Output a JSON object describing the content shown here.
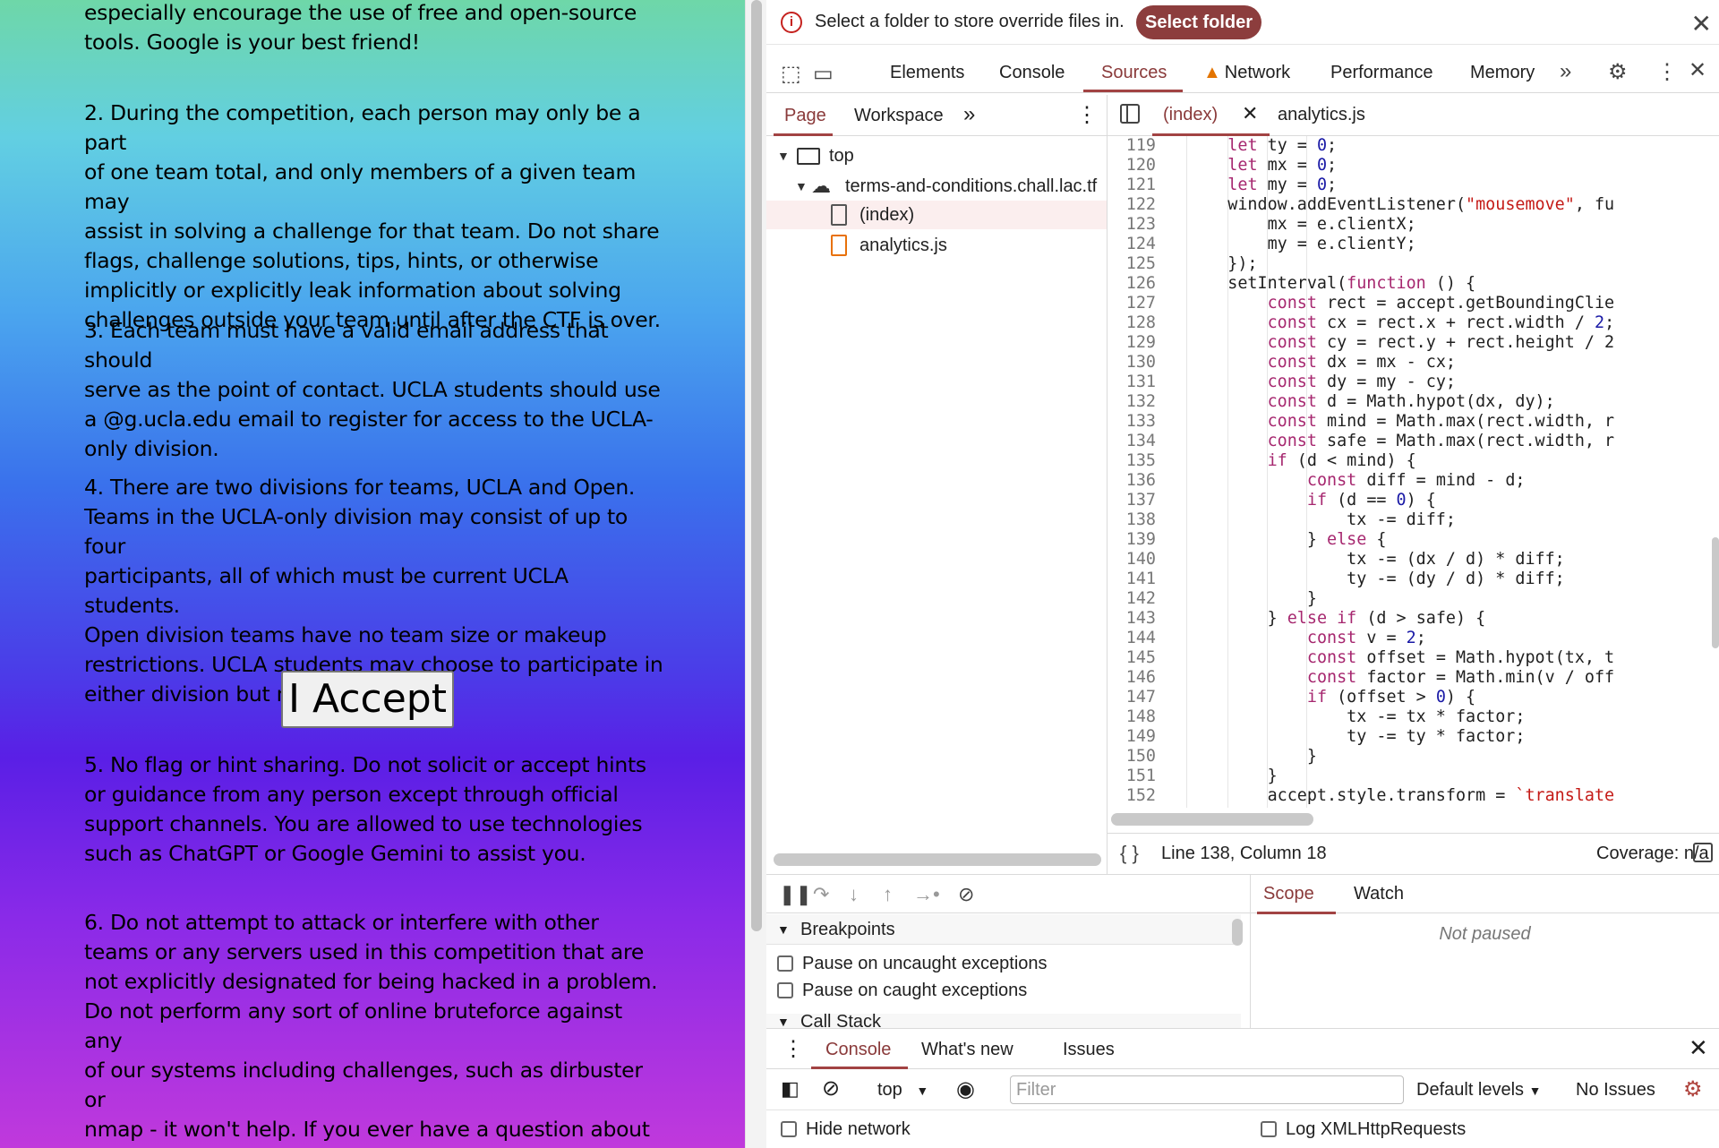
{
  "page": {
    "rules": [
      "especially encourage the use of free and open-source\ntools. Google is your best friend!",
      "2. During the competition, each person may only be a part\nof one team total, and only members of a given team may\nassist in solving a challenge for that team. Do not share\nflags, challenge solutions, tips, hints, or otherwise\nimplicitly or explicitly leak information about solving\nchallenges outside your team until after the CTF is over.",
      "3. Each team must have a valid email address that should\nserve as the point of contact. UCLA students should use\na @g.ucla.edu email to register for access to the UCLA-\nonly division.",
      "4. There are two divisions for teams, UCLA and Open.\nTeams in the UCLA-only division may consist of up to four\nparticipants, all of which must be current UCLA students.\nOpen division teams have no team size or makeup\nrestrictions. UCLA students may choose to participate in\neither division but not both.",
      "5. No flag or hint sharing. Do not solicit or accept hints\nor guidance from any person except through official\nsupport channels. You are allowed to use technologies\nsuch as ChatGPT or Google Gemini to assist you.",
      "6. Do not attempt to attack or interfere with other\nteams or any servers used in this competition that are\nnot explicitly designated for being hacked in a problem.\nDo not perform any sort of online bruteforce against any\nof our systems including challenges, such as dirbuster or\nnmap - it won't help. If you ever have a question about\nwhether something is allowed, please ask!"
    ],
    "accept_button": "I Accept"
  },
  "devtools": {
    "infobar": {
      "message": "Select a folder to store override files in.",
      "button": "Select folder"
    },
    "tabs": [
      "Elements",
      "Console",
      "Sources",
      "Network",
      "Performance",
      "Memory"
    ],
    "active_tab": "Sources",
    "navigator_tabs": [
      "Page",
      "Workspace"
    ],
    "tree": {
      "top": "top",
      "domain": "terms-and-conditions.chall.lac.tf",
      "files": [
        "(index)",
        "analytics.js"
      ]
    },
    "editor_tabs": [
      "(index)",
      "analytics.js"
    ],
    "code_lines": [
      {
        "n": "119",
        "code": "    let ty = 0;"
      },
      {
        "n": "120",
        "code": "    let mx = 0;"
      },
      {
        "n": "121",
        "code": "    let my = 0;"
      },
      {
        "n": "122",
        "code": "    window.addEventListener(\"mousemove\", fu"
      },
      {
        "n": "123",
        "code": "        mx = e.clientX;"
      },
      {
        "n": "124",
        "code": "        my = e.clientY;"
      },
      {
        "n": "125",
        "code": "    });"
      },
      {
        "n": "126",
        "code": "    setInterval(function () {"
      },
      {
        "n": "127",
        "code": "        const rect = accept.getBoundingClie"
      },
      {
        "n": "128",
        "code": "        const cx = rect.x + rect.width / 2;"
      },
      {
        "n": "129",
        "code": "        const cy = rect.y + rect.height / 2"
      },
      {
        "n": "130",
        "code": "        const dx = mx - cx;"
      },
      {
        "n": "131",
        "code": "        const dy = my - cy;"
      },
      {
        "n": "132",
        "code": "        const d = Math.hypot(dx, dy);"
      },
      {
        "n": "133",
        "code": "        const mind = Math.max(rect.width, r"
      },
      {
        "n": "134",
        "code": "        const safe = Math.max(rect.width, r"
      },
      {
        "n": "135",
        "code": "        if (d < mind) {"
      },
      {
        "n": "136",
        "code": "            const diff = mind - d;"
      },
      {
        "n": "137",
        "code": "            if (d == 0) {"
      },
      {
        "n": "138",
        "code": "                tx -= diff;"
      },
      {
        "n": "139",
        "code": "            } else {"
      },
      {
        "n": "140",
        "code": "                tx -= (dx / d) * diff;"
      },
      {
        "n": "141",
        "code": "                ty -= (dy / d) * diff;"
      },
      {
        "n": "142",
        "code": "            }"
      },
      {
        "n": "143",
        "code": "        } else if (d > safe) {"
      },
      {
        "n": "144",
        "code": "            const v = 2;"
      },
      {
        "n": "145",
        "code": "            const offset = Math.hypot(tx, t"
      },
      {
        "n": "146",
        "code": "            const factor = Math.min(v / off"
      },
      {
        "n": "147",
        "code": "            if (offset > 0) {"
      },
      {
        "n": "148",
        "code": "                tx -= tx * factor;"
      },
      {
        "n": "149",
        "code": "                ty -= ty * factor;"
      },
      {
        "n": "150",
        "code": "            }"
      },
      {
        "n": "151",
        "code": "        }"
      },
      {
        "n": "152",
        "code": "        accept.style.transform = `translate"
      }
    ],
    "status": {
      "position": "Line 138, Column 18",
      "coverage": "Coverage: n/a"
    },
    "scope_tabs": [
      "Scope",
      "Watch"
    ],
    "breakpoints_header": "Breakpoints",
    "pause_uncaught": "Pause on uncaught exceptions",
    "pause_caught": "Pause on caught exceptions",
    "call_stack": "Call Stack",
    "not_paused": "Not paused",
    "drawer_tabs": [
      "Console",
      "What's new",
      "Issues"
    ],
    "console": {
      "context": "top",
      "filter_placeholder": "Filter",
      "levels": "Default levels",
      "issues": "No Issues",
      "hide_network": "Hide network",
      "log_xhr": "Log XMLHttpRequests"
    }
  }
}
